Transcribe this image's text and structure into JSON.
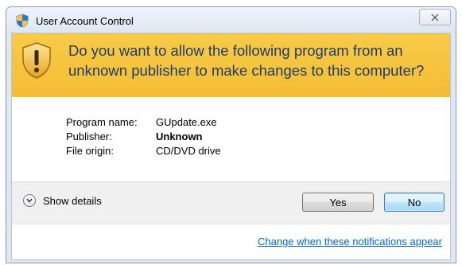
{
  "window": {
    "title": "User Account Control",
    "close_label": "Close"
  },
  "banner": {
    "message": "Do you want to allow the following program from an unknown publisher to make changes to this computer?"
  },
  "info": {
    "rows": [
      {
        "label": "Program name:",
        "value": "GUpdate.exe"
      },
      {
        "label": "Publisher:",
        "value": "Unknown"
      },
      {
        "label": "File origin:",
        "value": "CD/DVD drive"
      }
    ]
  },
  "actions": {
    "show_details": "Show details",
    "yes": "Yes",
    "no": "No"
  },
  "footer": {
    "link": "Change when these notifications appear"
  },
  "icons": {
    "title": "uac-shield-icon",
    "warning": "warning-shield-icon",
    "details_toggle": "chevron-down-icon",
    "close": "close-icon"
  },
  "colors": {
    "banner_bg": "#f3bd34",
    "banner_text": "#1c3d6e",
    "link": "#0066cc",
    "default_button_border": "#3c7fb1"
  }
}
